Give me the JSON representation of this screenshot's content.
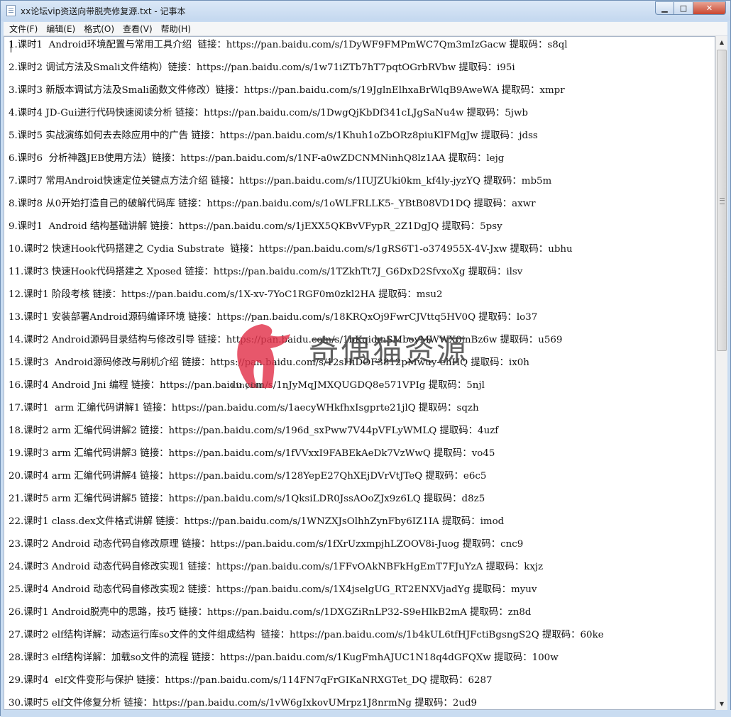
{
  "window": {
    "title": "xx论坛vip资送向带脱壳修复源.txt - 记事本",
    "min_glyph": "▁",
    "max_glyph": "□",
    "close_glyph": "✕"
  },
  "menu": [
    "文件(F)",
    "编辑(E)",
    "格式(O)",
    "查看(V)",
    "帮助(H)"
  ],
  "lines": [
    "1.课时1  Android环境配置与常用工具介绍  链接：https://pan.baidu.com/s/1DyWF9FMPmWC7Qm3mIzGacw 提取码：s8ql",
    "2.课时2 调试方法及Smali文件结构）链接：https://pan.baidu.com/s/1w71iZTb7hT7pqtOGrbRVbw 提取码：i95i",
    "3.课时3 新版本调试方法及Smali函数文件修改）链接：https://pan.baidu.com/s/19JglnElhxaBrWlqB9AweWA 提取码：xmpr",
    "4.课时4 JD-Gui进行代码快速阅读分析 链接：https://pan.baidu.com/s/1DwgQjKbDf341cLJgSaNu4w 提取码：5jwb",
    "5.课时5 实战演练如何去去除应用中的广告 链接：https://pan.baidu.com/s/1Khuh1oZbORz8piuKlFMgJw 提取码：jdss",
    "6.课时6  分析神器JEB使用方法）链接：https://pan.baidu.com/s/1NF-a0wZDCNMNinhQ8lz1AA 提取码：lejg",
    "7.课时7 常用Android快速定位关键点方法介绍 链接：https://pan.baidu.com/s/1IUJZUki0km_kf4ly-jyzYQ 提取码：mb5m",
    "8.课时8 从0开始打造自己的破解代码库 链接：https://pan.baidu.com/s/1oWLFRLLK5-_YBtB08VD1DQ 提取码：axwr",
    "9.课时1  Android 结构基础讲解 链接：https://pan.baidu.com/s/1jEXX5QKBvVFypR_2Z1DgJQ 提取码：5psy",
    "10.课时2 快速Hook代码搭建之 Cydia Substrate  链接：https://pan.baidu.com/s/1gRS6T1-o374955X-4V-Jxw 提取码：ubhu",
    "11.课时3 快速Hook代码搭建之 Xposed 链接：https://pan.baidu.com/s/1TZkhTt7J_G6DxD2SfvxoXg 提取码：ilsv",
    "12.课时1 阶段考核 链接：https://pan.baidu.com/s/1X-xv-7YoC1RGF0m0zkl2HA 提取码：msu2",
    "13.课时1 安装部署Android源码编译环境 链接：https://pan.baidu.com/s/18KRQxOj9FwrCJVttq5HV0Q 提取码：lo37",
    "14.课时2 Android源码目录结构与修改引导 链接：https://pan.baidu.com/s/1bKqidmSMboyMWWX0inBz6w 提取码：u569",
    "15.课时3  Android源码修改与刷机介绍 链接：https://pan.baidu.com/s/12sHiDOF3812pMwuy-ehHQ 提取码：ix0h",
    "16.课时4 Android Jni 编程 链接：https://pan.baidu.com/s/1nJyMqJMXQUGDQ8e571VPIg 提取码：5njl",
    "17.课时1  arm 汇编代码讲解1 链接：https://pan.baidu.com/s/1aecyWHkfhxIsgprte21jlQ 提取码：sqzh",
    "18.课时2 arm 汇编代码讲解2 链接：https://pan.baidu.com/s/196d_sxPww7V44pVFLyWMLQ 提取码：4uzf",
    "19.课时3 arm 汇编代码讲解3 链接：https://pan.baidu.com/s/1fVVxxI9FABEkAeDk7VzWwQ 提取码：vo45",
    "20.课时4 arm 汇编代码讲解4 链接：https://pan.baidu.com/s/128YepE27QhXEjDVrVtJTeQ 提取码：e6c5",
    "21.课时5 arm 汇编代码讲解5 链接：https://pan.baidu.com/s/1QksiLDR0JssAOoZJx9z6LQ 提取码：d8z5",
    "22.课时1 class.dex文件格式讲解 链接：https://pan.baidu.com/s/1WNZXJsOlhhZynFby6IZ1IA 提取码：imod",
    "23.课时2 Android 动态代码自修改原理 链接：https://pan.baidu.com/s/1fXrUzxmpjhLZOOV8i-Juog 提取码：cnc9",
    "24.课时3 Android 动态代码自修改实现1 链接：https://pan.baidu.com/s/1FFvOAkNBFkHgEmT7FJuYzA 提取码：kxjz",
    "25.课时4 Android 动态代码自修改实现2 链接：https://pan.baidu.com/s/1X4jselgUG_RT2ENXVjadYg 提取码：myuv",
    "26.课时1 Android脱壳中的思路，技巧 链接：https://pan.baidu.com/s/1DXGZiRnLP32-S9eHlkB2mA 提取码：zn8d",
    "27.课时2 elf结构详解：动态运行库so文件的文件组成结构  链接：https://pan.baidu.com/s/1b4kUL6tfHJFctiBgsngS2Q 提取码：60ke",
    "28.课时3 elf结构详解：加载so文件的流程 链接：https://pan.baidu.com/s/1KugFmhAJUC1N18q4dGFQXw 提取码：100w",
    "29.课时4  elf文件变形与保护 链接：https://pan.baidu.com/s/114FN7qFrGIKaNRXGTet_DQ 提取码：6287",
    "30.课时5 elf文件修复分析 链接：https://pan.baidu.com/s/1vW6gIxkovUMrpz1J8nrmNg 提取码：2ud9"
  ],
  "watermark": {
    "text": "奇偶猫资源",
    "url": "xinyimm"
  },
  "scrollbar": {
    "up_glyph": "▲",
    "down_glyph": "▼"
  },
  "colors": {
    "watermark_logo": "#e2334b",
    "titlebar": "#c9dcf1",
    "close_button": "#c9452e"
  }
}
